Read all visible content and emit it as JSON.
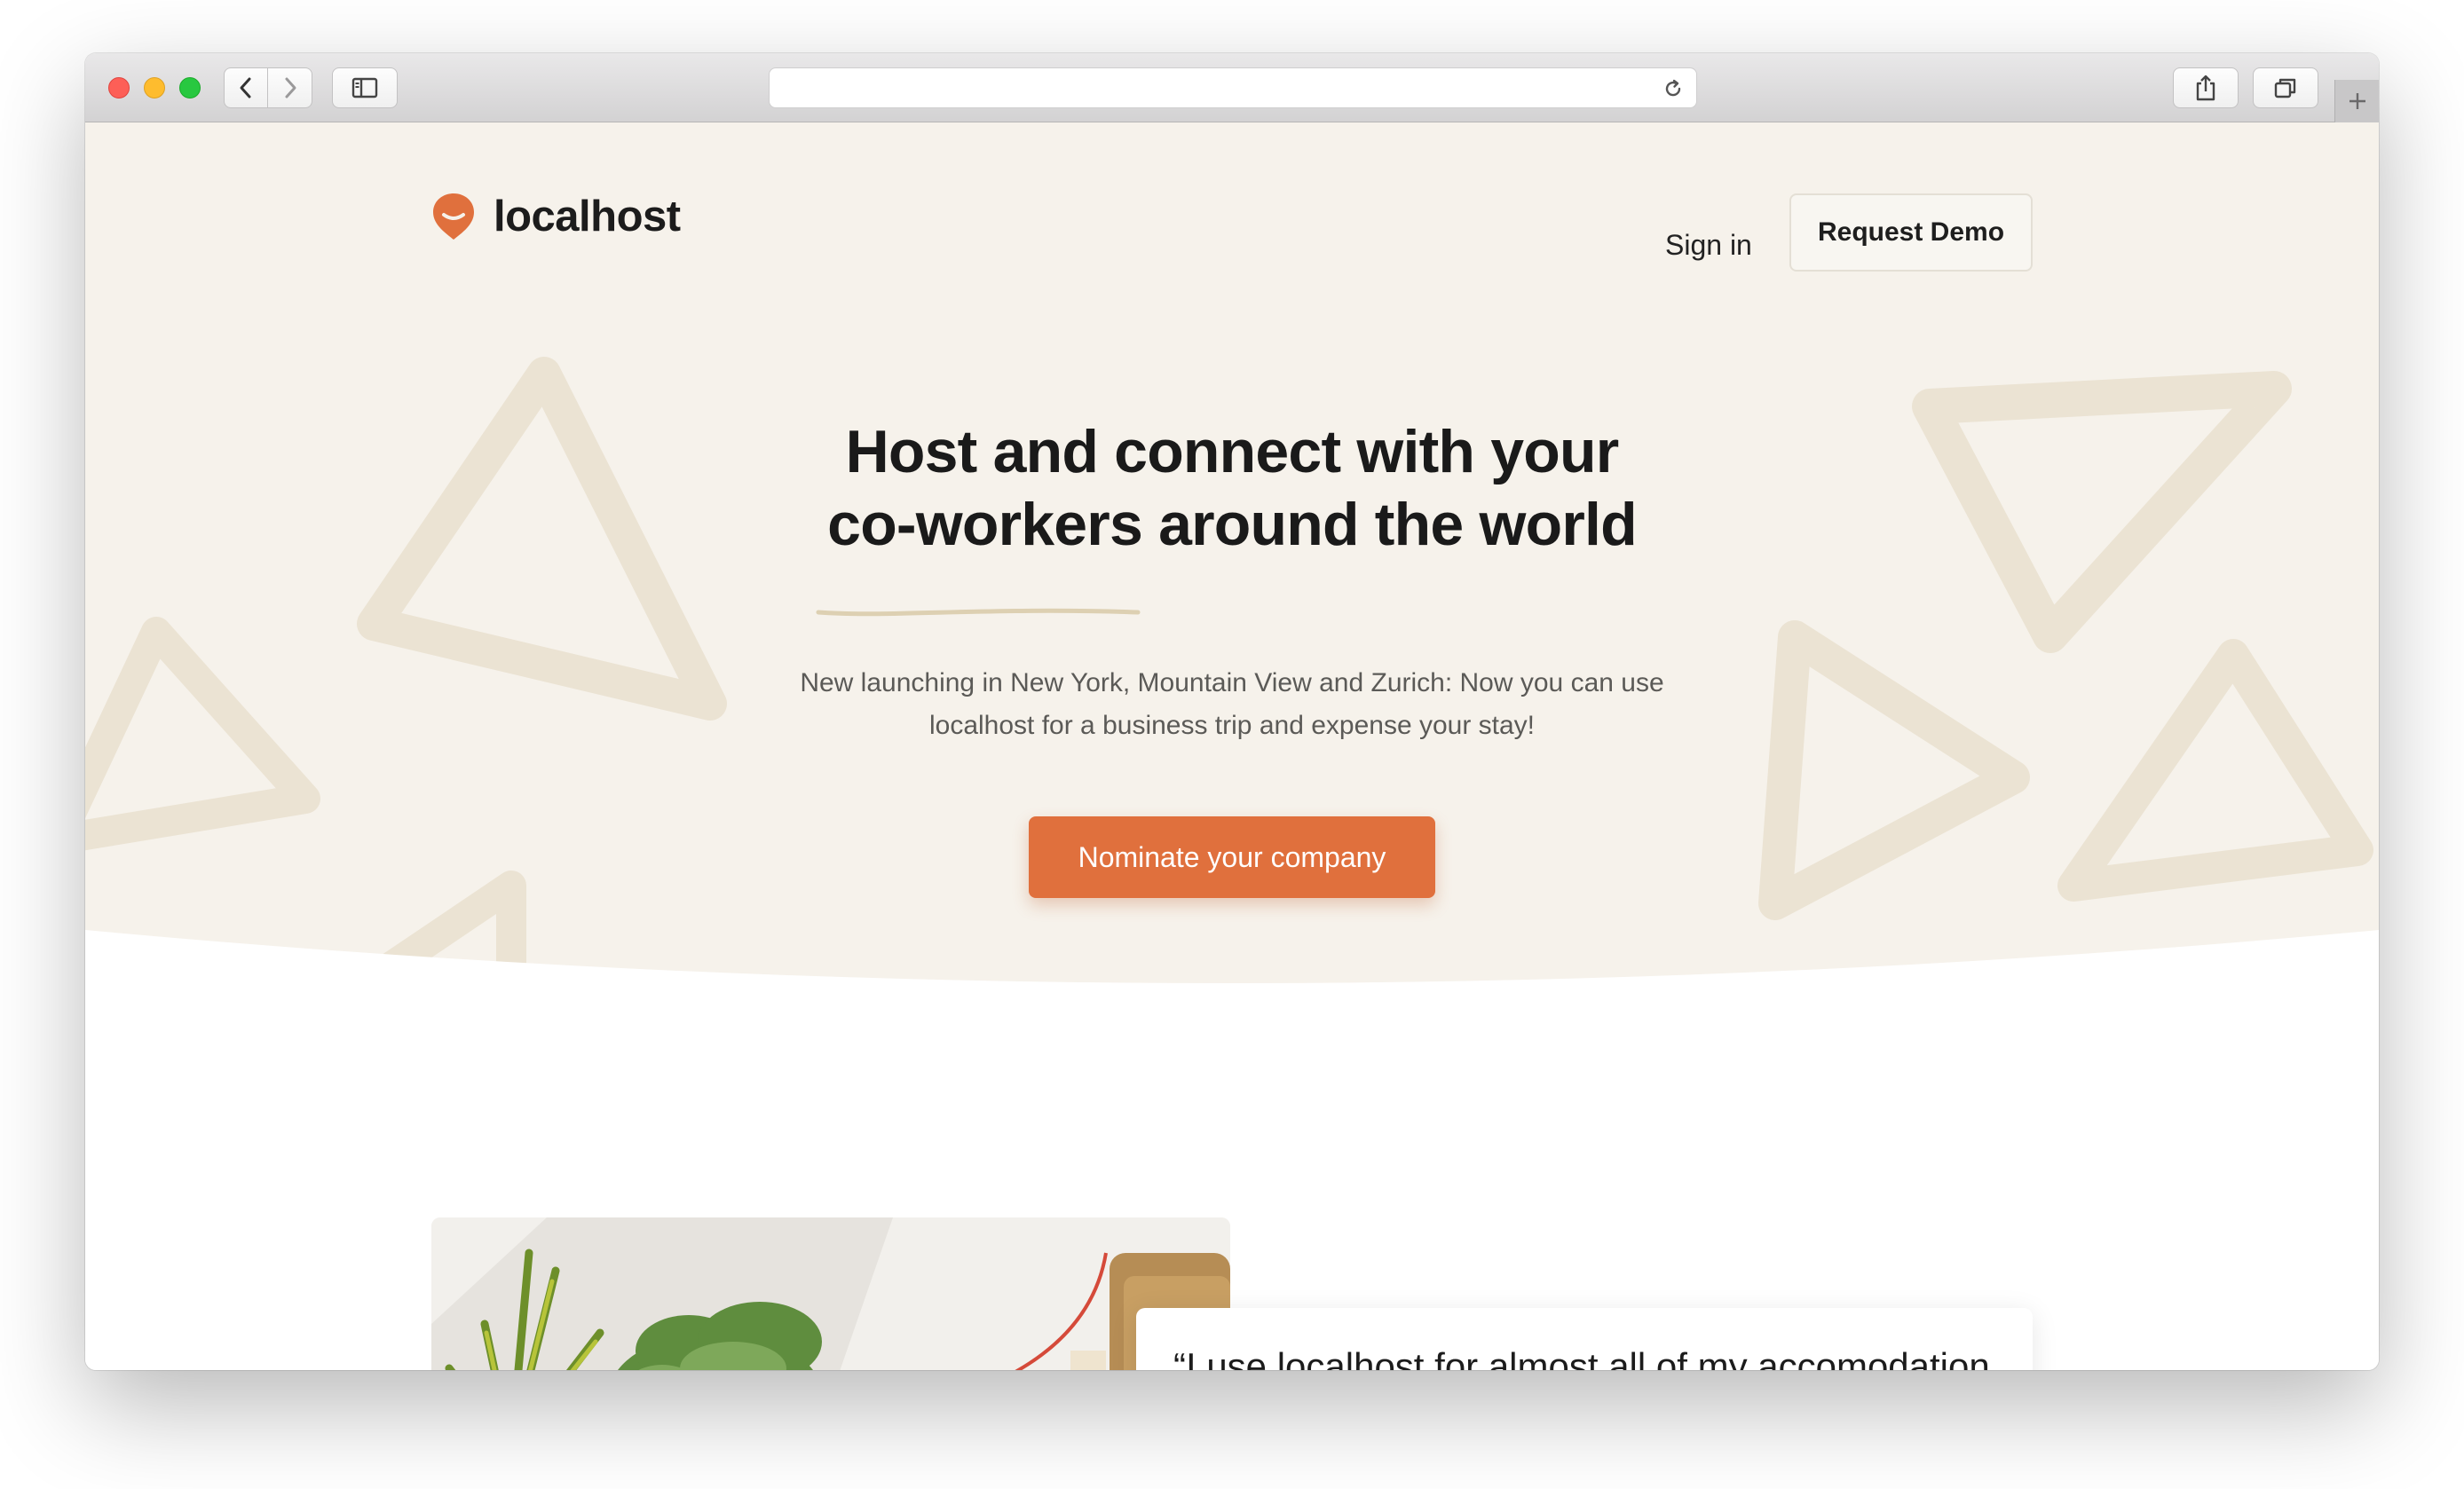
{
  "browser": {
    "address_text": "",
    "icons": [
      "back-icon",
      "forward-icon",
      "sidebar-icon",
      "reload-icon",
      "share-icon",
      "tabs-icon",
      "plus-icon"
    ]
  },
  "brand": {
    "name": "localhost",
    "accent_color": "#e0703d",
    "hero_background": "#f6f2eb",
    "shape_color": "#ebe3d3"
  },
  "nav": {
    "sign_in": "Sign in",
    "request_demo": "Request Demo"
  },
  "hero": {
    "headline_line1": "Host and connect with your",
    "headline_line2_part1": "co-workers",
    "headline_line2_part2": " around the world",
    "subtext": "New launching in New York, Mountain View and Zurich: Now you can use localhost for a business trip and expense your stay!",
    "cta": "Nominate your company"
  },
  "testimonial": {
    "quote": "“I use localhost for almost all of my accomodation needs abroad. It’s a perfect"
  }
}
